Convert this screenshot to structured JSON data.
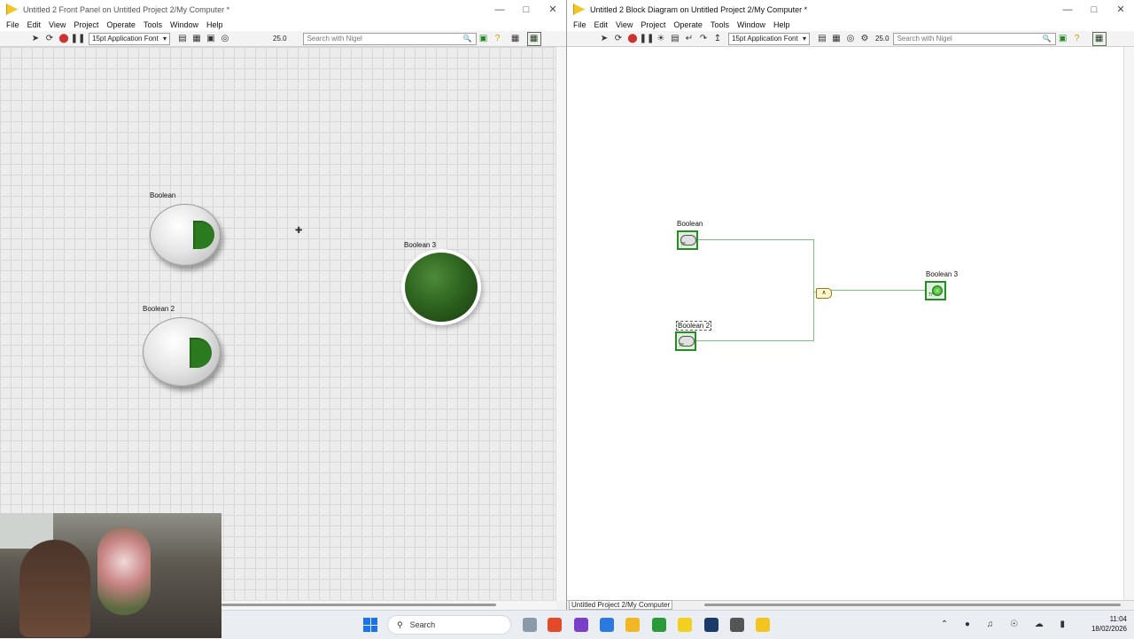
{
  "front_panel": {
    "title": "Untitled 2 Front Panel on Untitled Project 2/My Computer *",
    "menu": [
      "File",
      "Edit",
      "View",
      "Project",
      "Operate",
      "Tools",
      "Window",
      "Help"
    ],
    "font": "15pt Application Font",
    "zoom": "25.0",
    "search_placeholder": "Search with Nigel",
    "controls": {
      "boolean_label": "Boolean",
      "boolean2_label": "Boolean 2",
      "boolean3_label": "Boolean 3"
    }
  },
  "block_diagram": {
    "title": "Untitled 2 Block Diagram on Untitled Project 2/My Computer *",
    "menu": [
      "File",
      "Edit",
      "View",
      "Project",
      "Operate",
      "Tools",
      "Window",
      "Help"
    ],
    "font": "15pt Application Font",
    "zoom": "25.0",
    "search_placeholder": "Search with Nigel",
    "terminals": {
      "boolean_label": "Boolean",
      "boolean2_label": "Boolean 2",
      "boolean3_label": "Boolean 3",
      "tf_text": "TF",
      "and_symbol": "∧"
    },
    "status": "Untitled Project 2/My Computer"
  },
  "taskbar": {
    "search_label": "Search",
    "time": "11:04",
    "date": "18/02/2026"
  },
  "colors": {
    "led_on": "#2c7a1f",
    "terminal_border": "#2a8a2a",
    "wire": "#7cc27c"
  }
}
